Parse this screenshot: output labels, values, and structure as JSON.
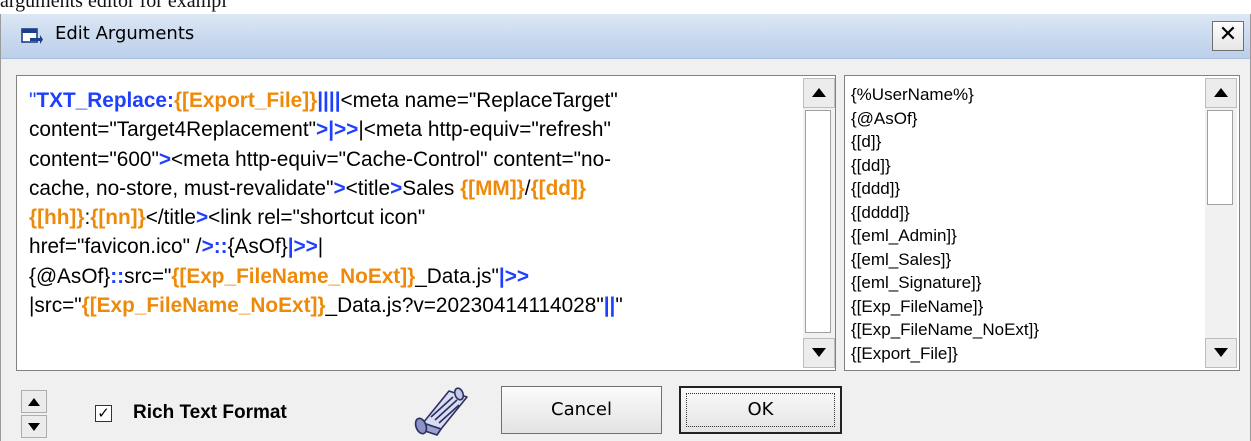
{
  "doc_fragment": "arguments editor for exampl",
  "dialog": {
    "title": "Edit Arguments",
    "close_label": "✕"
  },
  "editor": {
    "lines": [
      [
        [
          "blue",
          "\"",
          false
        ],
        [
          "blue",
          "TXT_Replace:",
          true
        ],
        [
          "orange",
          "{[Export_File]}",
          true
        ],
        [
          "blue",
          "||||",
          true
        ],
        [
          "black",
          "<meta name=\"ReplaceTarget\"",
          false
        ]
      ],
      [
        [
          "black",
          "content=\"Target4Replacement\"",
          false
        ],
        [
          "blue",
          ">",
          true
        ],
        [
          "blue",
          "|>>",
          true
        ],
        [
          "black",
          "|<meta http-equiv=\"refresh\"",
          false
        ]
      ],
      [
        [
          "black",
          "content=\"600\"",
          false
        ],
        [
          "blue",
          ">",
          true
        ],
        [
          "black",
          "<meta http-equiv=\"Cache-Control\" content=\"no-",
          false
        ]
      ],
      [
        [
          "black",
          "cache, no-store, must-revalidate\"",
          false
        ],
        [
          "blue",
          ">",
          true
        ],
        [
          "black",
          "<title",
          false
        ],
        [
          "blue",
          ">",
          true
        ],
        [
          "black",
          "Sales ",
          false
        ],
        [
          "orange",
          "{[MM]}",
          true
        ],
        [
          "black",
          "/",
          false
        ],
        [
          "orange",
          "{[dd]}",
          true
        ]
      ],
      [
        [
          "orange",
          "{[hh]}",
          true
        ],
        [
          "black",
          ":",
          false
        ],
        [
          "orange",
          "{[nn]}",
          true
        ],
        [
          "black",
          "</title",
          false
        ],
        [
          "blue",
          ">",
          true
        ],
        [
          "black",
          "<link rel=\"shortcut icon\"",
          false
        ]
      ],
      [
        [
          "black",
          "href=\"favicon.ico\" /",
          false
        ],
        [
          "blue",
          ">::",
          true
        ],
        [
          "black",
          "{AsOf}",
          false
        ],
        [
          "blue",
          "|>>",
          true
        ],
        [
          "black",
          "|",
          false
        ]
      ],
      [
        [
          "black",
          "{@AsOf}",
          false
        ],
        [
          "blue",
          "::",
          true
        ],
        [
          "black",
          "src=\"",
          false
        ],
        [
          "orange",
          "{[Exp_FileName_NoExt]}",
          true
        ],
        [
          "black",
          "_Data.js\"",
          false
        ],
        [
          "blue",
          "|>>",
          true
        ]
      ],
      [
        [
          "black",
          "|src=\"",
          false
        ],
        [
          "orange",
          "{[Exp_FileName_NoExt]}",
          true
        ],
        [
          "black",
          "_Data.js?v=20230414114028\"",
          false
        ],
        [
          "blue",
          "||",
          true
        ],
        [
          "black",
          "\"",
          false
        ]
      ]
    ]
  },
  "list": {
    "items": [
      "{%UserName%}",
      "{@AsOf}",
      "{[d]}",
      "{[dd]}",
      "{[ddd]}",
      "{[dddd]}",
      "{[eml_Admin]}",
      "{[eml_Sales]}",
      "{[eml_Signature]}",
      "{[Exp_FileName]}",
      "{[Exp_FileName_NoExt]}",
      "{[Export_File]}"
    ]
  },
  "footer": {
    "rich_text_label": "Rich Text Format",
    "rich_text_checked": true,
    "check_mark": "✓",
    "cancel_label": "Cancel",
    "ok_label": "OK"
  },
  "icons": {
    "title_icon": "dialog-edit-icon",
    "scroll_button_icon": "scroll-parchment-icon"
  },
  "colors": {
    "keyword_blue": "#1f3fff",
    "token_orange": "#ee8a0a",
    "titlebar": "#c9d9ee"
  }
}
